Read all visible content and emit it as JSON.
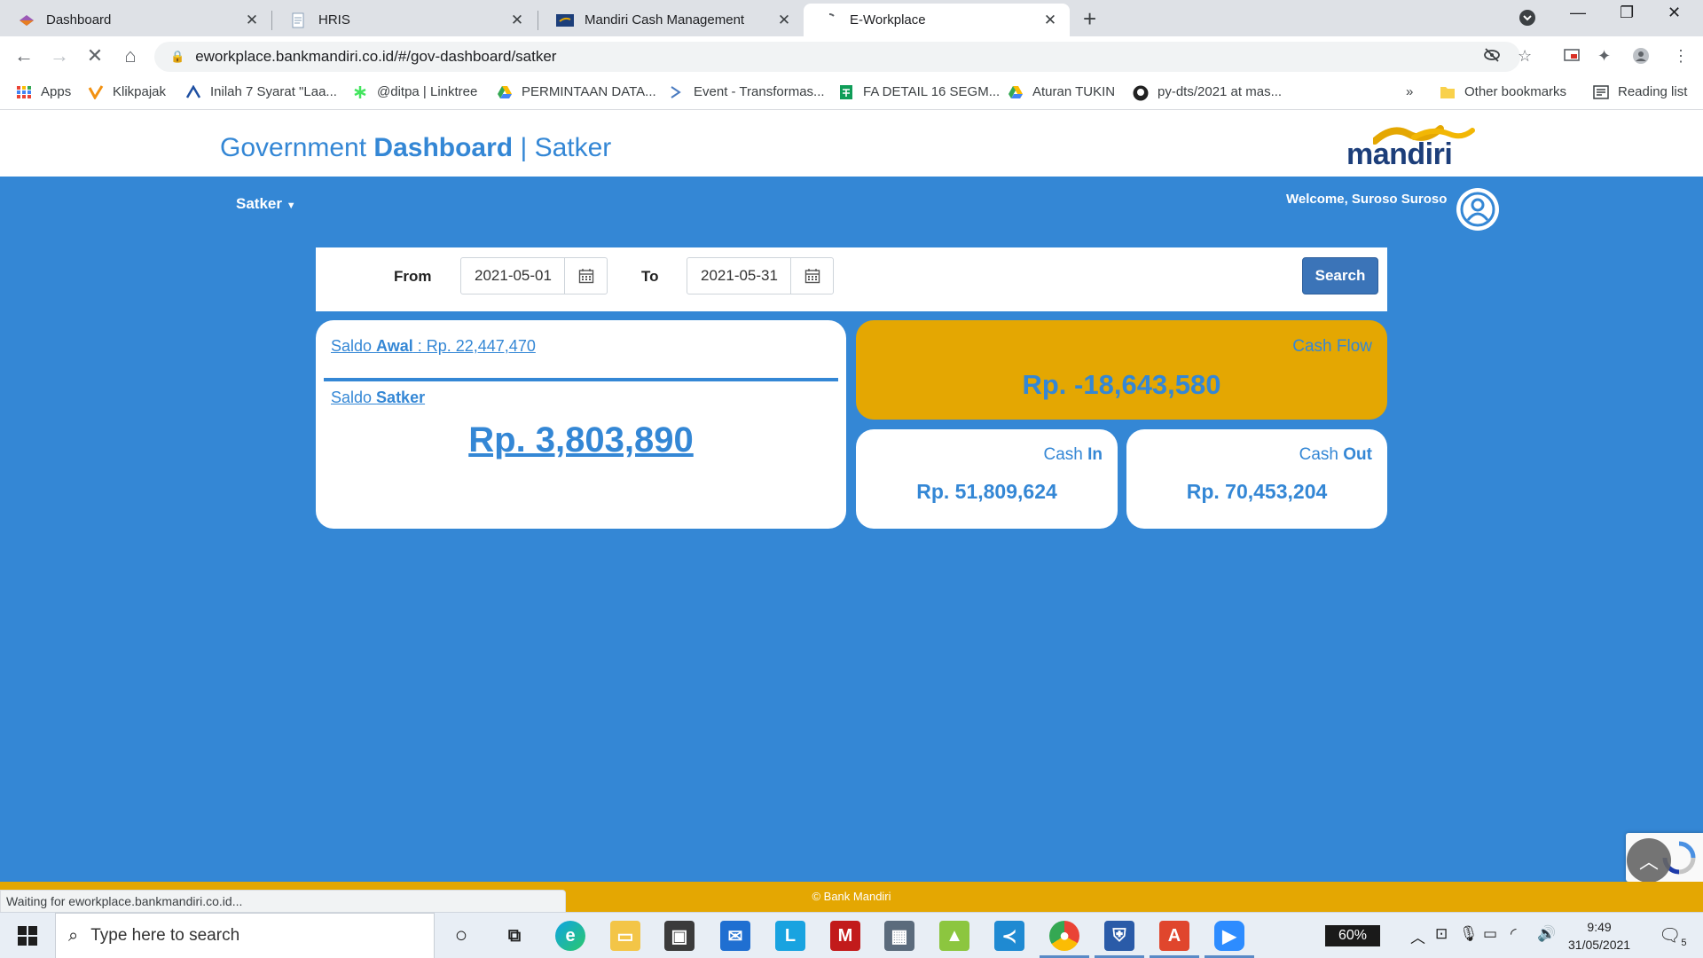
{
  "browser": {
    "tabs": [
      {
        "title": "Dashboard"
      },
      {
        "title": "HRIS"
      },
      {
        "title": "Mandiri Cash Management"
      },
      {
        "title": "E-Workplace"
      }
    ],
    "url": "eworkplace.bankmandiri.co.id/#/gov-dashboard/satker",
    "bookmarks": [
      "Apps",
      "Klikpajak",
      "Inilah 7 Syarat \"Laa...",
      "@ditpa | Linktree",
      "PERMINTAAN DATA...",
      "Event - Transformas...",
      "FA DETAIL 16 SEGM...",
      "Aturan TUKIN",
      "py-dts/2021 at mas...",
      "Other bookmarks",
      "Reading list"
    ],
    "bookmarks_overflow": "»",
    "status_text": "Waiting for eworkplace.bankmandiri.co.id..."
  },
  "page": {
    "title_part1": "Government ",
    "title_part2": "Dashboard",
    "title_part3": " | Satker",
    "logo_text": "mandiri",
    "nav_menu": "Satker",
    "welcome": "Welcome, Suroso Suroso",
    "filter": {
      "from_label": "From",
      "from_value": "2021-05-01",
      "to_label": "To",
      "to_value": "2021-05-31",
      "search_label": "Search"
    },
    "saldo_awal_part1": "Saldo ",
    "saldo_awal_part2": "Awal",
    "saldo_awal_part3": " : Rp. 22,447,470",
    "saldo_satker_part1": "Saldo ",
    "saldo_satker_part2": "Satker",
    "saldo_satker_value": "Rp. 3,803,890",
    "cash_flow_label": "Cash Flow",
    "cash_flow_value": "Rp. -18,643,580",
    "cash_in_part1": "Cash ",
    "cash_in_part2": "In",
    "cash_in_value": "Rp. 51,809,624",
    "cash_out_part1": "Cash ",
    "cash_out_part2": "Out",
    "cash_out_value": "Rp. 70,453,204",
    "footer": "© Bank Mandiri",
    "colors": {
      "primary": "#3487d5",
      "accent": "#e4a702",
      "logo_navy": "#1c3e7a"
    }
  },
  "taskbar": {
    "search_placeholder": "Type here to search",
    "battery": "60%",
    "time": "9:49",
    "date": "31/05/2021",
    "notifications": "5"
  }
}
